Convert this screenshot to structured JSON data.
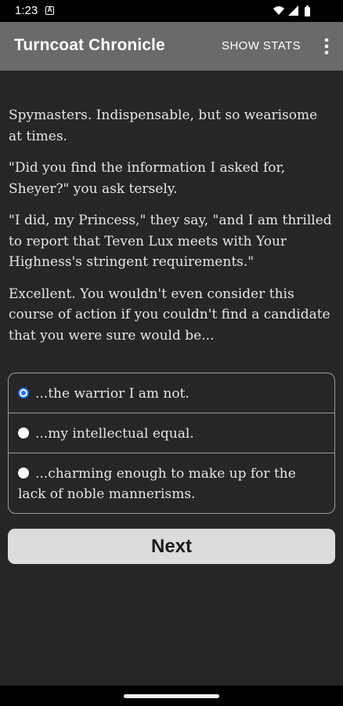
{
  "status_bar": {
    "time": "1:23",
    "notification_icon": "a-icon",
    "icons": [
      "wifi-icon",
      "signal-icon",
      "battery-icon"
    ]
  },
  "app_bar": {
    "title": "Turncoat Chronicle",
    "show_stats_label": "SHOW STATS",
    "menu_icon": "more-vert-icon"
  },
  "story": {
    "paragraphs": [
      "Spymasters. Indispensable, but so wearisome at times.",
      "\"Did you find the information I asked for, Sheyer?\" you ask tersely.",
      "\"I did, my Princess,\" they say, \"and I am thrilled to report that Teven Lux meets with Your Highness's stringent requirements.\"",
      "Excellent. You wouldn't even consider this course of action if you couldn't find a candidate that you were sure would be..."
    ]
  },
  "choices": [
    {
      "label": "...the warrior I am not.",
      "selected": true
    },
    {
      "label": "...my intellectual equal.",
      "selected": false
    },
    {
      "label": "...charming enough to make up for the lack of noble mannerisms.",
      "selected": false
    }
  ],
  "next_button": {
    "label": "Next"
  },
  "colors": {
    "background": "#262626",
    "app_bar": "#6a6a6a",
    "accent": "#1f6fe5",
    "button": "#dcdcdc"
  }
}
